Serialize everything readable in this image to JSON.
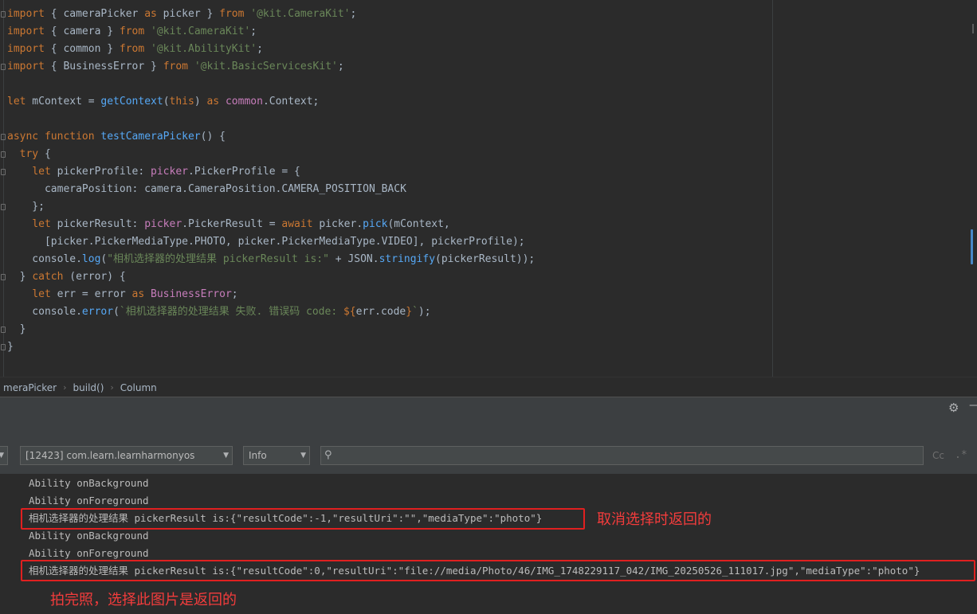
{
  "editor": {
    "lines": [
      [
        [
          "kw",
          "import"
        ],
        [
          "t",
          " { cameraPicker "
        ],
        [
          "kw",
          "as"
        ],
        [
          "t",
          " picker } "
        ],
        [
          "kw",
          "from"
        ],
        [
          "t",
          " "
        ],
        [
          "str",
          "'@kit.CameraKit'"
        ],
        [
          "t",
          ";"
        ]
      ],
      [
        [
          "kw",
          "import"
        ],
        [
          "t",
          " { camera } "
        ],
        [
          "kw",
          "from"
        ],
        [
          "t",
          " "
        ],
        [
          "str",
          "'@kit.CameraKit'"
        ],
        [
          "t",
          ";"
        ]
      ],
      [
        [
          "kw",
          "import"
        ],
        [
          "t",
          " { common } "
        ],
        [
          "kw",
          "from"
        ],
        [
          "t",
          " "
        ],
        [
          "str",
          "'@kit.AbilityKit'"
        ],
        [
          "t",
          ";"
        ]
      ],
      [
        [
          "kw",
          "import"
        ],
        [
          "t",
          " { BusinessError } "
        ],
        [
          "kw",
          "from"
        ],
        [
          "t",
          " "
        ],
        [
          "str",
          "'@kit.BasicServicesKit'"
        ],
        [
          "t",
          ";"
        ]
      ],
      [],
      [
        [
          "kw",
          "let"
        ],
        [
          "t",
          " mContext = "
        ],
        [
          "fn",
          "getContext"
        ],
        [
          "t",
          "("
        ],
        [
          "kw",
          "this"
        ],
        [
          "t",
          ") "
        ],
        [
          "kw",
          "as"
        ],
        [
          "t",
          " "
        ],
        [
          "modref",
          "common"
        ],
        [
          "t",
          ".Context;"
        ]
      ],
      [],
      [
        [
          "kw",
          "async function"
        ],
        [
          "t",
          " "
        ],
        [
          "fn",
          "testCameraPicker"
        ],
        [
          "t",
          "() {"
        ]
      ],
      [
        [
          "t",
          "  "
        ],
        [
          "kw",
          "try"
        ],
        [
          "t",
          " {"
        ]
      ],
      [
        [
          "t",
          "    "
        ],
        [
          "kw",
          "let"
        ],
        [
          "t",
          " pickerProfile: "
        ],
        [
          "modref",
          "picker"
        ],
        [
          "t",
          ".PickerProfile = {"
        ]
      ],
      [
        [
          "t",
          "      cameraPosition: camera.CameraPosition.CAMERA_POSITION_BACK"
        ]
      ],
      [
        [
          "t",
          "    };"
        ]
      ],
      [
        [
          "t",
          "    "
        ],
        [
          "kw",
          "let"
        ],
        [
          "t",
          " pickerResult: "
        ],
        [
          "modref",
          "picker"
        ],
        [
          "t",
          ".PickerResult = "
        ],
        [
          "kw",
          "await"
        ],
        [
          "t",
          " picker."
        ],
        [
          "fn",
          "pick"
        ],
        [
          "t",
          "(mContext,"
        ]
      ],
      [
        [
          "t",
          "      [picker.PickerMediaType.PHOTO, picker.PickerMediaType.VIDEO], pickerProfile);"
        ]
      ],
      [
        [
          "t",
          "    console."
        ],
        [
          "fn",
          "log"
        ],
        [
          "t",
          "("
        ],
        [
          "str",
          "\"相机选择器的处理结果 pickerResult is:\""
        ],
        [
          "t",
          " + JSON."
        ],
        [
          "fn",
          "stringify"
        ],
        [
          "t",
          "(pickerResult));"
        ]
      ],
      [
        [
          "t",
          "  } "
        ],
        [
          "kw",
          "catch"
        ],
        [
          "t",
          " (error) {"
        ]
      ],
      [
        [
          "t",
          "    "
        ],
        [
          "kw",
          "let"
        ],
        [
          "t",
          " err = error "
        ],
        [
          "kw",
          "as"
        ],
        [
          "t",
          " "
        ],
        [
          "err",
          "BusinessError"
        ],
        [
          "t",
          ";"
        ]
      ],
      [
        [
          "t",
          "    console."
        ],
        [
          "fn",
          "error"
        ],
        [
          "t",
          "("
        ],
        [
          "str",
          "`相机选择器的处理结果 失败. 错误码 code: "
        ],
        [
          "kw",
          "${"
        ],
        [
          "t",
          "err.code"
        ],
        [
          "kw",
          "}"
        ],
        [
          "str",
          "`"
        ],
        [
          "t",
          ");"
        ]
      ],
      [
        [
          "t",
          "  }"
        ]
      ],
      [
        [
          "t",
          "}"
        ]
      ]
    ]
  },
  "breadcrumb": {
    "items": [
      "meraPicker",
      "build()",
      "Column"
    ]
  },
  "filters": {
    "device_value": "[12423] com.learn.learnharmonyos",
    "level_value": "Info",
    "search_placeholder": "",
    "match_case_label": "Cc",
    "regex_label": ".*"
  },
  "log": {
    "lines": [
      "Ability onBackground",
      "Ability onForeground",
      "相机选择器的处理结果 pickerResult is:{\"resultCode\":-1,\"resultUri\":\"\",\"mediaType\":\"photo\"}",
      "Ability onBackground",
      "Ability onForeground",
      "相机选择器的处理结果 pickerResult is:{\"resultCode\":0,\"resultUri\":\"file://media/Photo/46/IMG_1748229117_042/IMG_20250526_111017.jpg\",\"mediaType\":\"photo\"}"
    ]
  },
  "annotations": {
    "cancel_note": "取消选择时返回的",
    "photo_note": "拍完照，选择此图片是返回的"
  },
  "colors": {
    "annotation_red": "#f43c3c",
    "keyword": "#cc7832",
    "string": "#6a8759",
    "function": "#56a8f5"
  },
  "icons": {
    "settings": "gear-icon",
    "minimize": "minimize-icon",
    "search": "search-icon"
  }
}
